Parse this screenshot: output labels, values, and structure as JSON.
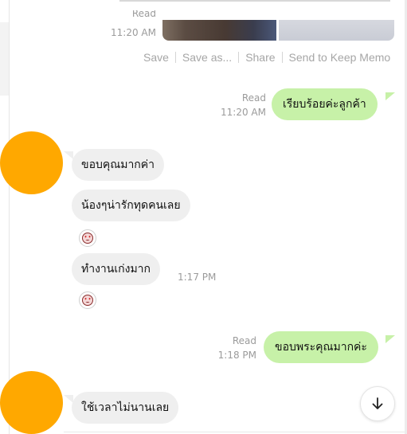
{
  "top_message": {
    "read_label": "Read",
    "time": "11:20 AM",
    "actions": [
      "Save",
      "Save as...",
      "Share",
      "Send to Keep Memo"
    ]
  },
  "messages": [
    {
      "direction": "out",
      "text": "เรียบร้อยค่ะลูกค้า",
      "read_label": "Read",
      "time": "11:20 AM"
    },
    {
      "direction": "in",
      "text": "ขอบคุณมากค่า"
    },
    {
      "direction": "in",
      "text": "น้องๆน่ารักทุดคนเลย"
    },
    {
      "direction": "in",
      "type": "sticker",
      "icon": "heart-eyes-emoji-icon"
    },
    {
      "direction": "in",
      "text": "ทำงานเก่งมาก",
      "time": "1:17 PM"
    },
    {
      "direction": "in",
      "type": "sticker",
      "icon": "heart-eyes-emoji-icon"
    },
    {
      "direction": "out",
      "text": "ขอบพระคุณมากค่ะ",
      "read_label": "Read",
      "time": "1:18 PM"
    },
    {
      "direction": "in",
      "text": "ใช้เวลาไม่นานเลย"
    }
  ],
  "colors": {
    "outgoing_bubble": "#c7f1a8",
    "incoming_bubble": "#efefef",
    "avatar": "#ffa800",
    "meta_text": "#9b9b9b"
  },
  "scroll_button": {
    "icon": "arrow-down-icon"
  }
}
